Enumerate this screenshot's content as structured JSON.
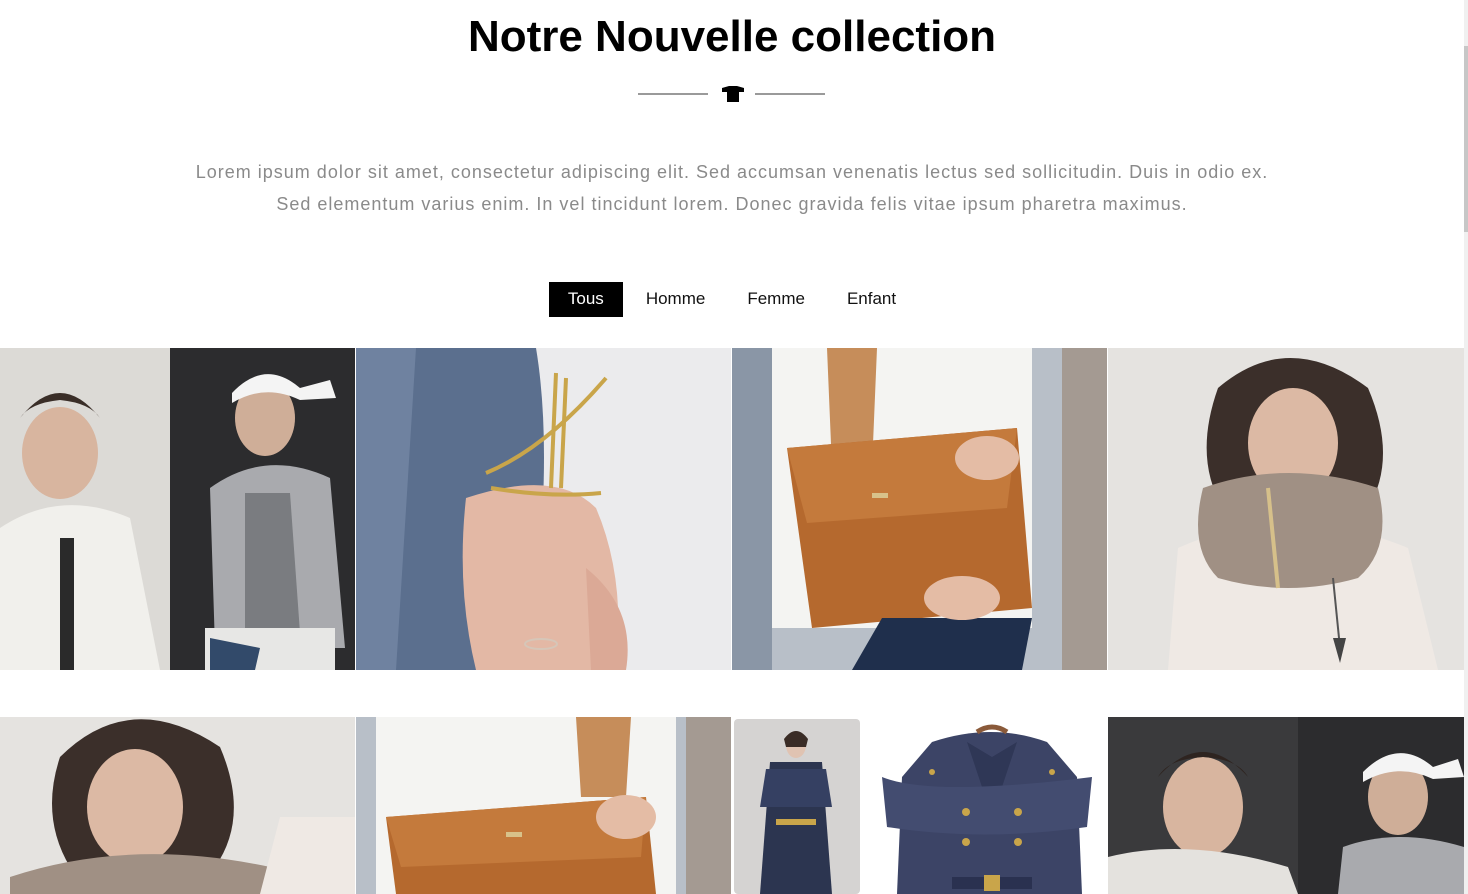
{
  "section": {
    "title": "Notre Nouvelle collection",
    "divider_icon": "tshirt-icon",
    "intro_line1": "Lorem ipsum dolor sit amet, consectetur adipiscing elit. Sed accumsan venenatis lectus sed sollicitudin. Duis in odio ex.",
    "intro_line2": "Sed elementum varius enim. In vel tincidunt lorem. Donec gravida felis vitae ipsum pharetra maximus."
  },
  "filters": [
    {
      "label": "Tous",
      "active": true
    },
    {
      "label": "Homme",
      "active": false
    },
    {
      "label": "Femme",
      "active": false
    },
    {
      "label": "Enfant",
      "active": false
    }
  ],
  "gallery": {
    "row1": [
      {
        "image": "men-jackets-photo"
      },
      {
        "image": "gold-bracelet-photo"
      },
      {
        "image": "leather-clutch-photo"
      },
      {
        "image": "woman-knit-scarf-photo"
      }
    ],
    "row2": [
      {
        "image": "woman-knit-scarf-photo"
      },
      {
        "image": "leather-clutch-photo"
      },
      {
        "image": "navy-trench-coat-photo"
      },
      {
        "image": "men-jackets-photo"
      }
    ]
  },
  "colors": {
    "active_filter_bg": "#000000",
    "active_filter_text": "#ffffff",
    "intro_text": "#8a8a8a",
    "divider_line": "#9a9a9a"
  }
}
